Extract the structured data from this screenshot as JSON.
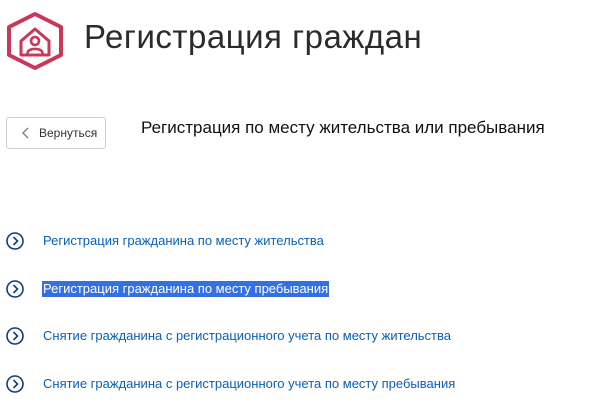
{
  "header": {
    "title": "Регистрация граждан",
    "logo_icon": "house-person-icon",
    "accent_color": "#c8385a"
  },
  "back_button": {
    "label": "Вернуться",
    "icon": "chevron-left-icon"
  },
  "page_heading": "Регистрация по месту жительства или пребывания",
  "links": [
    {
      "label": "Регистрация гражданина по месту жительства",
      "selected": false
    },
    {
      "label": "Регистрация гражданина по месту пребывания",
      "selected": true
    },
    {
      "label": "Снятие гражданина с регистрационного учета по месту жительства",
      "selected": false
    },
    {
      "label": "Снятие гражданина с регистрационного учета по месту пребывания",
      "selected": false
    }
  ],
  "link_icon": "chevron-right-circle-icon",
  "link_color": "#0a60b4",
  "selection_color": "#3470e4"
}
